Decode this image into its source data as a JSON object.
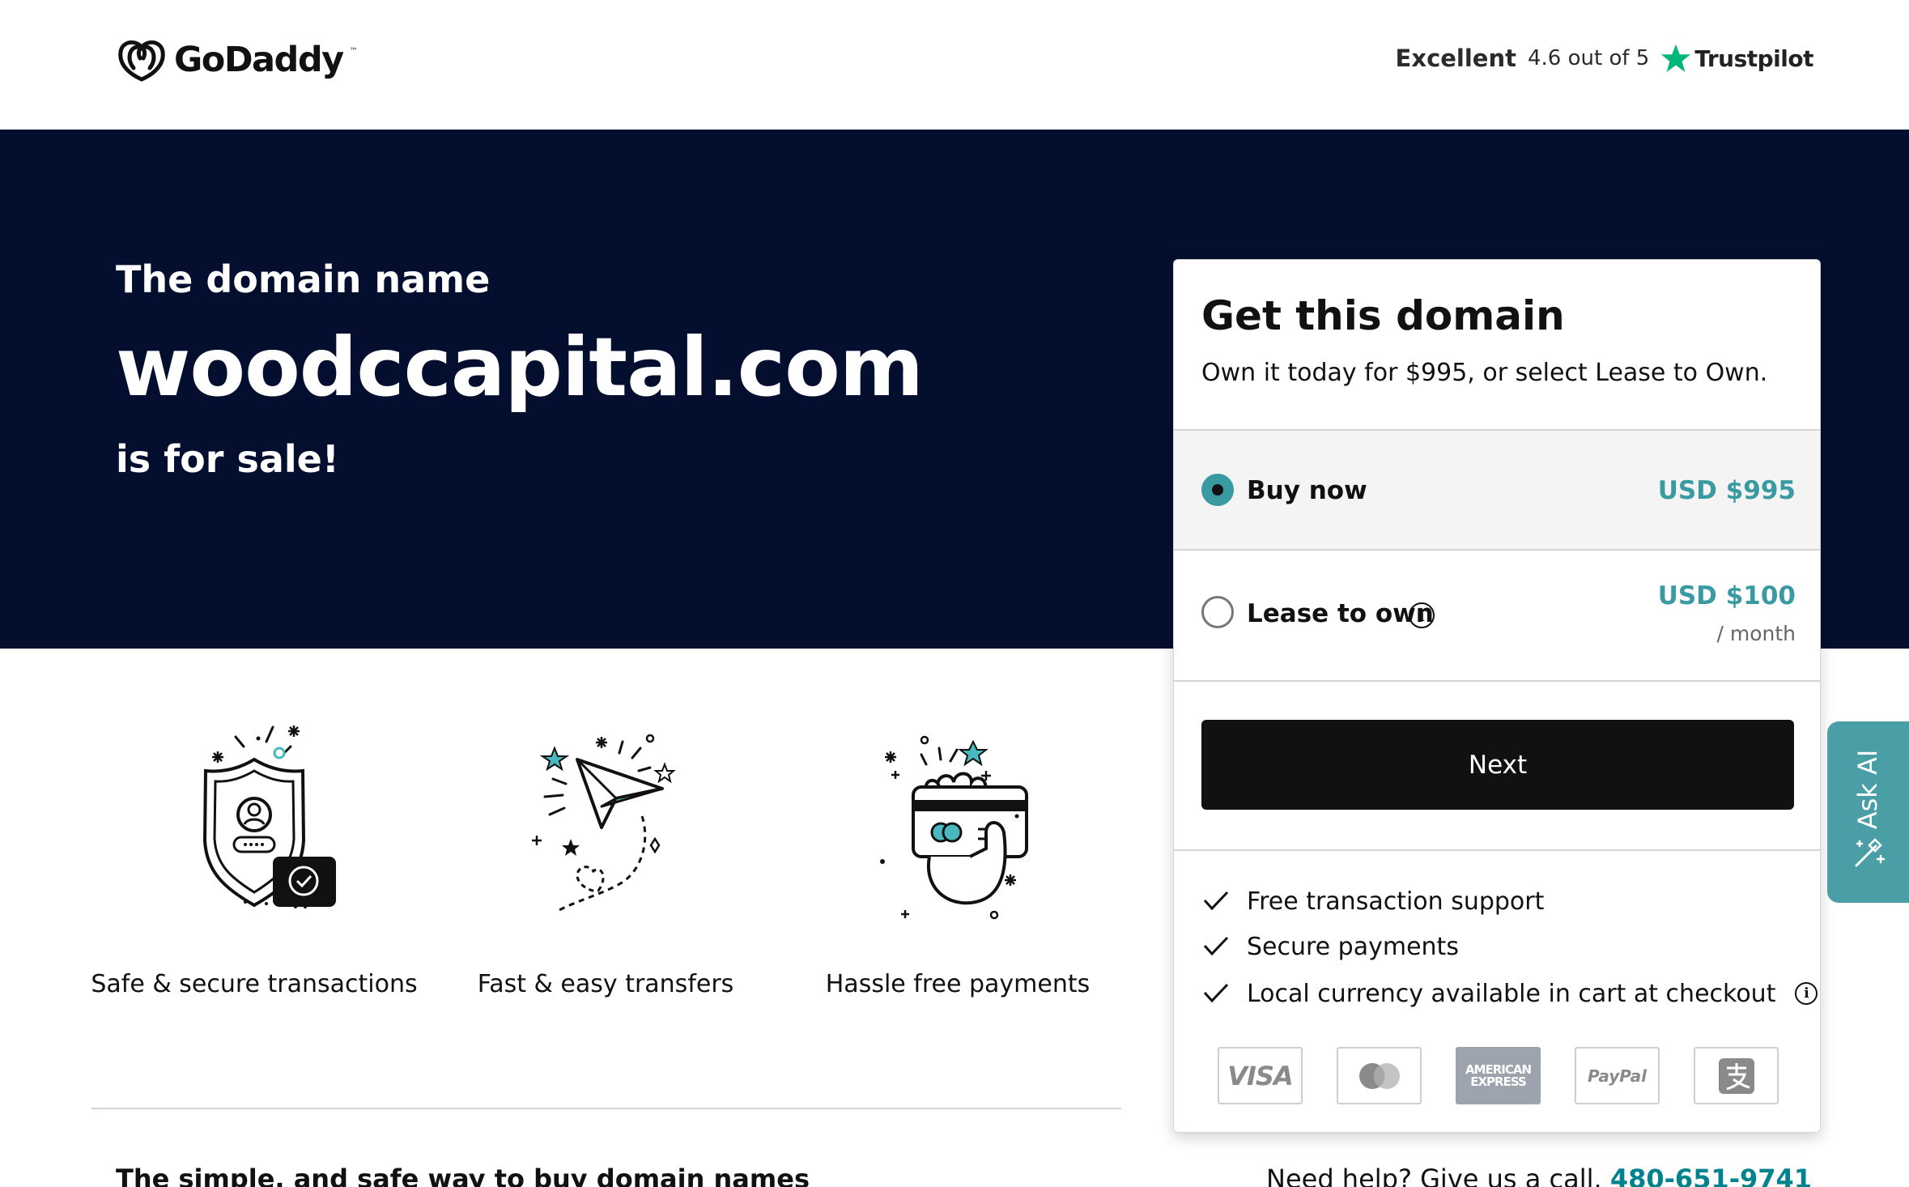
{
  "header": {
    "brand": "GoDaddy",
    "brand_mark": "™",
    "trustpilot": {
      "rating_word": "Excellent",
      "score": "4.6 out of 5",
      "brand": "Trustpilot",
      "star_color": "#00b67a"
    }
  },
  "hero": {
    "pre": "The domain name",
    "domain": "woodccapital.com",
    "post": "is for sale!",
    "background": "#040f2f"
  },
  "features": [
    {
      "label": "Safe & secure transactions",
      "icon": "shield-check-icon"
    },
    {
      "label": "Fast & easy transfers",
      "icon": "paper-plane-icon"
    },
    {
      "label": "Hassle free payments",
      "icon": "card-in-hand-icon"
    }
  ],
  "card": {
    "title": "Get this domain",
    "subtitle": "Own it today for $995, or select Lease to Own.",
    "options": [
      {
        "label": "Buy now",
        "price": "USD $995",
        "selected": true
      },
      {
        "label": "Lease to own",
        "price": "USD $100",
        "period": "/ month",
        "selected": false
      }
    ],
    "next_label": "Next",
    "benefits": [
      "Free transaction support",
      "Secure payments",
      "Local currency available in cart at checkout"
    ],
    "payment_methods": {
      "visa": "VISA",
      "amex_line1": "AMERICAN",
      "amex_line2": "EXPRESS",
      "paypal": "PayPal"
    },
    "accent_color": "#3a9aa2"
  },
  "footer": {
    "tagline": "The simple, and safe way to buy domain names",
    "help_text": "Need help? Give us a call.",
    "phone": "480-651-9741"
  },
  "ask_ai": {
    "label": "Ask AI",
    "color": "#4a9ea6"
  }
}
